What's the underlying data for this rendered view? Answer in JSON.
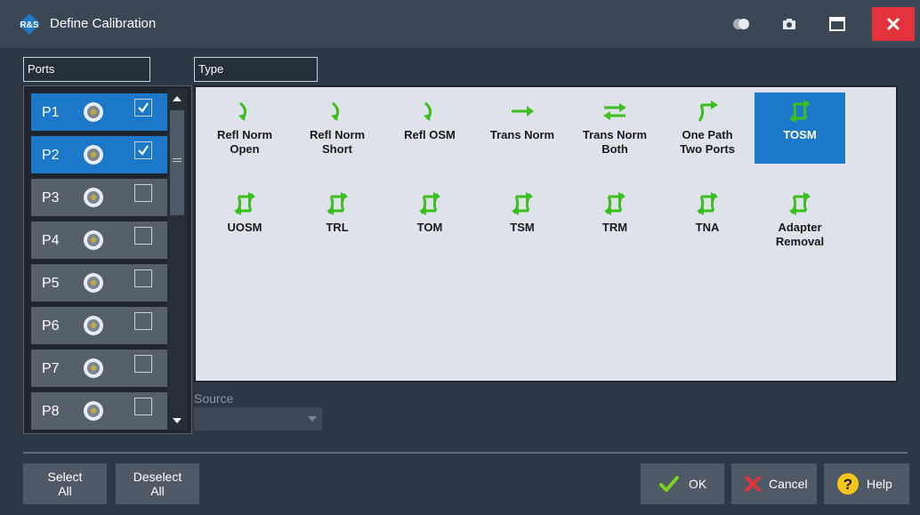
{
  "window": {
    "title": "Define Calibration"
  },
  "colors": {
    "accent": "#1c78c8",
    "arrow_green": "#3cbe1e",
    "close_red": "#e2333c"
  },
  "ports": {
    "header": "Ports",
    "items": [
      {
        "label": "P1",
        "checked": true
      },
      {
        "label": "P2",
        "checked": true
      },
      {
        "label": "P3",
        "checked": false
      },
      {
        "label": "P4",
        "checked": false
      },
      {
        "label": "P5",
        "checked": false
      },
      {
        "label": "P6",
        "checked": false
      },
      {
        "label": "P7",
        "checked": false
      },
      {
        "label": "P8",
        "checked": false
      }
    ]
  },
  "type": {
    "header": "Type",
    "items": [
      {
        "label": "Refl Norm\nOpen",
        "icon": "refl-arrow-icon"
      },
      {
        "label": "Refl Norm\nShort",
        "icon": "refl-arrow-icon"
      },
      {
        "label": "Refl OSM",
        "icon": "refl-arrow-icon"
      },
      {
        "label": "Trans Norm",
        "icon": "right-arrow-icon"
      },
      {
        "label": "Trans Norm\nBoth",
        "icon": "bidirectional-arrow-icon"
      },
      {
        "label": "One Path\nTwo Ports",
        "icon": "one-path-arrow-icon"
      },
      {
        "label": "TOSM",
        "icon": "two-port-arrows-icon",
        "selected": true
      },
      {
        "label": "UOSM",
        "icon": "two-port-arrows-icon"
      },
      {
        "label": "TRL",
        "icon": "two-port-arrows-icon"
      },
      {
        "label": "TOM",
        "icon": "two-port-arrows-icon"
      },
      {
        "label": "TSM",
        "icon": "two-port-arrows-icon"
      },
      {
        "label": "TRM",
        "icon": "two-port-arrows-icon"
      },
      {
        "label": "TNA",
        "icon": "two-port-arrows-icon"
      },
      {
        "label": "Adapter\nRemoval",
        "icon": "two-port-arrows-icon"
      }
    ]
  },
  "source": {
    "label": "Source",
    "value": ""
  },
  "buttons": {
    "select_all": "Select\nAll",
    "deselect_all": "Deselect\nAll",
    "ok": "OK",
    "cancel": "Cancel",
    "help": "Help"
  }
}
